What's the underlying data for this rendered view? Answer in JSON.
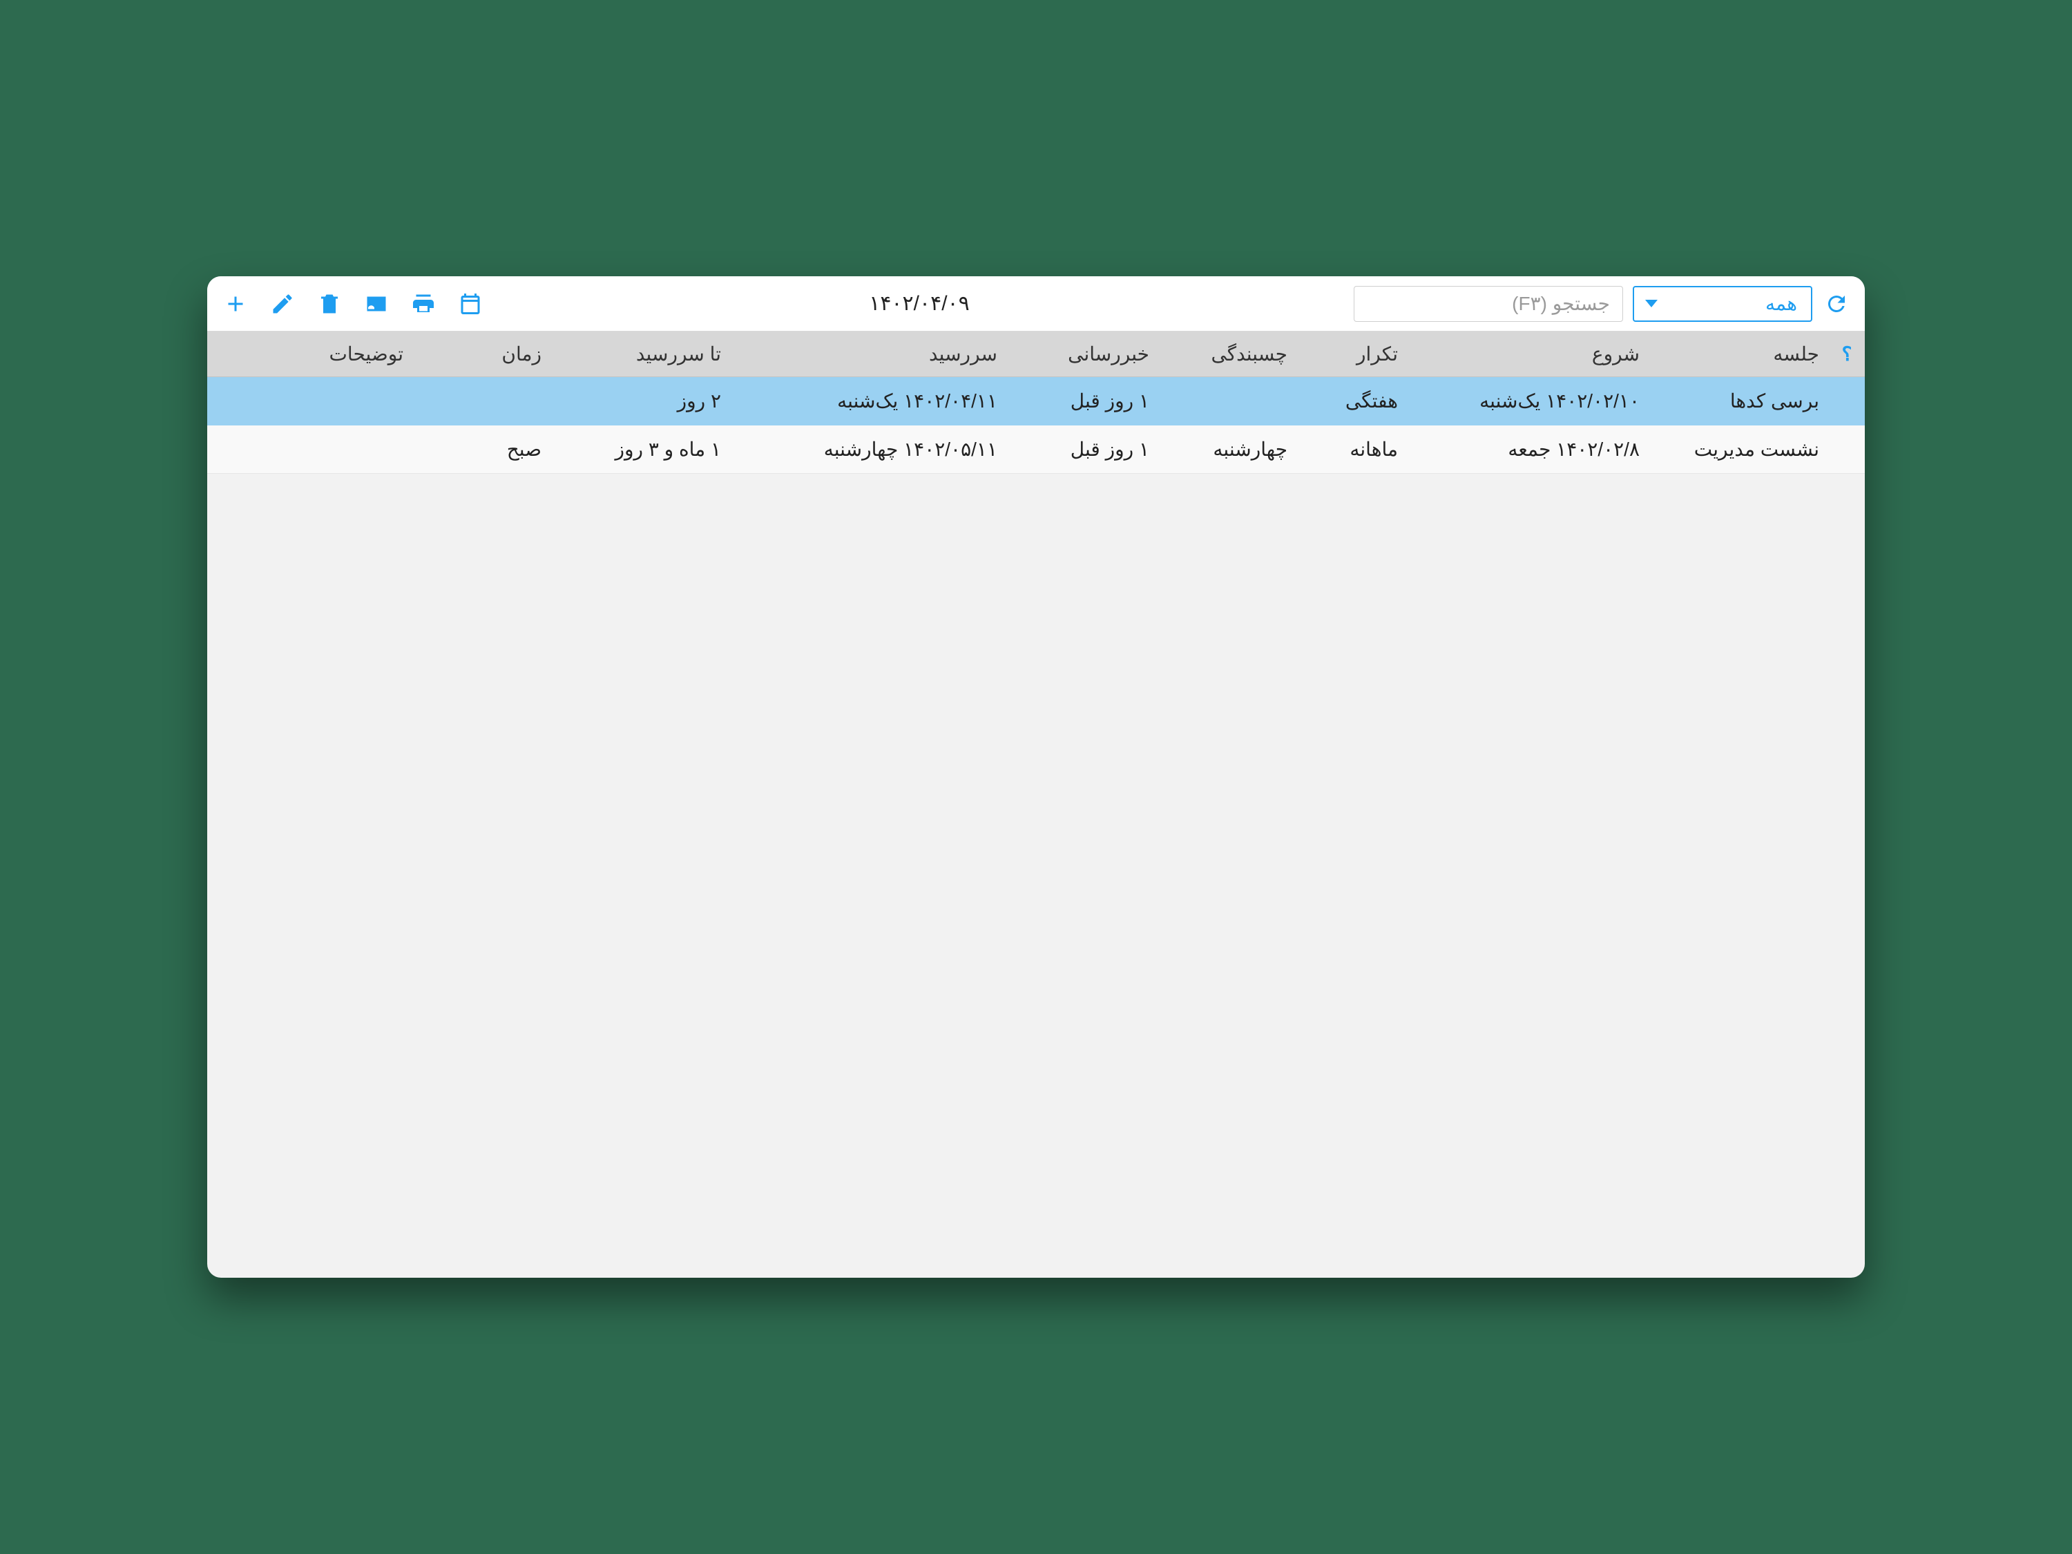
{
  "toolbar": {
    "date": "۱۴۰۲/۰۴/۰۹",
    "search_placeholder": "جستجو (F۳)",
    "filter_label": "همه"
  },
  "columns": {
    "help": "؟",
    "session": "جلسه",
    "start": "شروع",
    "repeat": "تکرار",
    "stickiness": "چسبندگی",
    "notify": "خبررسانی",
    "due": "سررسید",
    "until_due": "تا سررسید",
    "time": "زمان",
    "desc": "توضیحات"
  },
  "rows": [
    {
      "selected": true,
      "session": "برسی کدها",
      "start": "۱۴۰۲/۰۲/۱۰ یک‌شنبه",
      "repeat": "هفتگی",
      "stickiness": "",
      "notify": "۱ روز قبل",
      "due": "۱۴۰۲/۰۴/۱۱ یک‌شنبه",
      "until_due": "۲ روز",
      "time": "",
      "desc": ""
    },
    {
      "selected": false,
      "session": "نشست مدیریت",
      "start": "۱۴۰۲/۰۲/۸ جمعه",
      "repeat": "ماهانه",
      "stickiness": "چهارشنبه",
      "notify": "۱ روز قبل",
      "due": "۱۴۰۲/۰۵/۱۱ چهارشنبه",
      "until_due": "۱ ماه و ۳ روز",
      "time": "صبح",
      "desc": ""
    }
  ]
}
